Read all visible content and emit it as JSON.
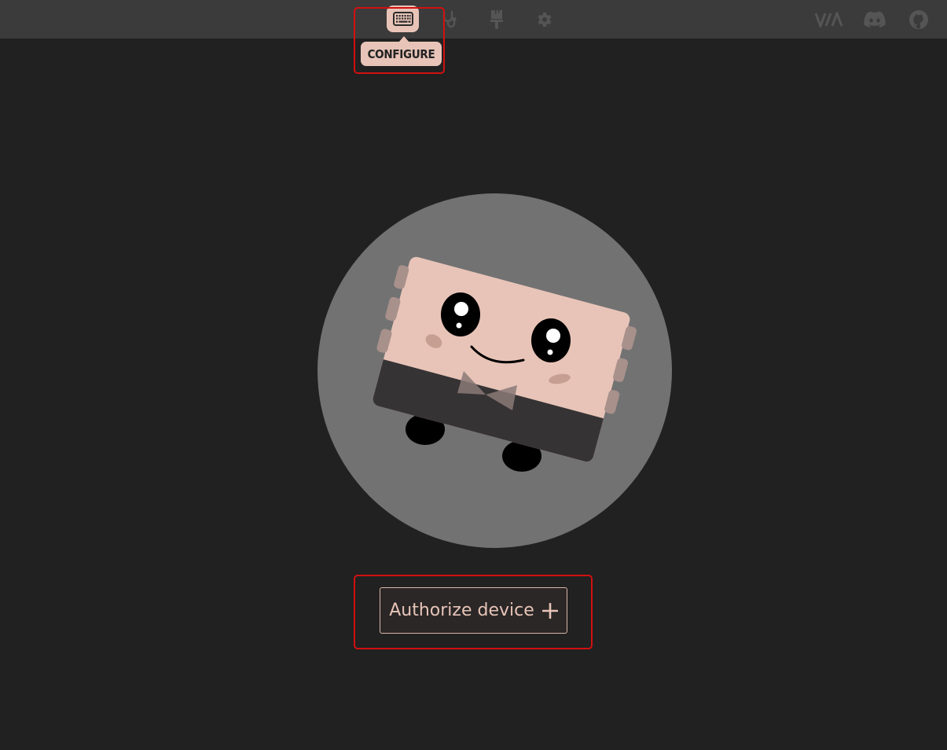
{
  "colors": {
    "background": "#212121",
    "topbar": "#3b3b3b",
    "accent": "#e8c4b8",
    "icon_inactive": "#5a5a5a",
    "highlight": "#d21010"
  },
  "nav": {
    "items": [
      {
        "name": "configure",
        "icon": "keyboard-icon",
        "active": true
      },
      {
        "name": "test",
        "icon": "stethoscope-icon",
        "active": false
      },
      {
        "name": "design",
        "icon": "paintbrush-icon",
        "active": false
      },
      {
        "name": "settings",
        "icon": "gear-icon",
        "active": false
      }
    ],
    "tooltip": "CONFIGURE"
  },
  "external_links": [
    {
      "name": "via",
      "icon": "via-logo-icon"
    },
    {
      "name": "discord",
      "icon": "discord-icon"
    },
    {
      "name": "github",
      "icon": "github-icon"
    }
  ],
  "main": {
    "mascot": "keyboard-mascot-icon",
    "authorize_label": "Authorize device",
    "authorize_icon": "plus-icon"
  }
}
